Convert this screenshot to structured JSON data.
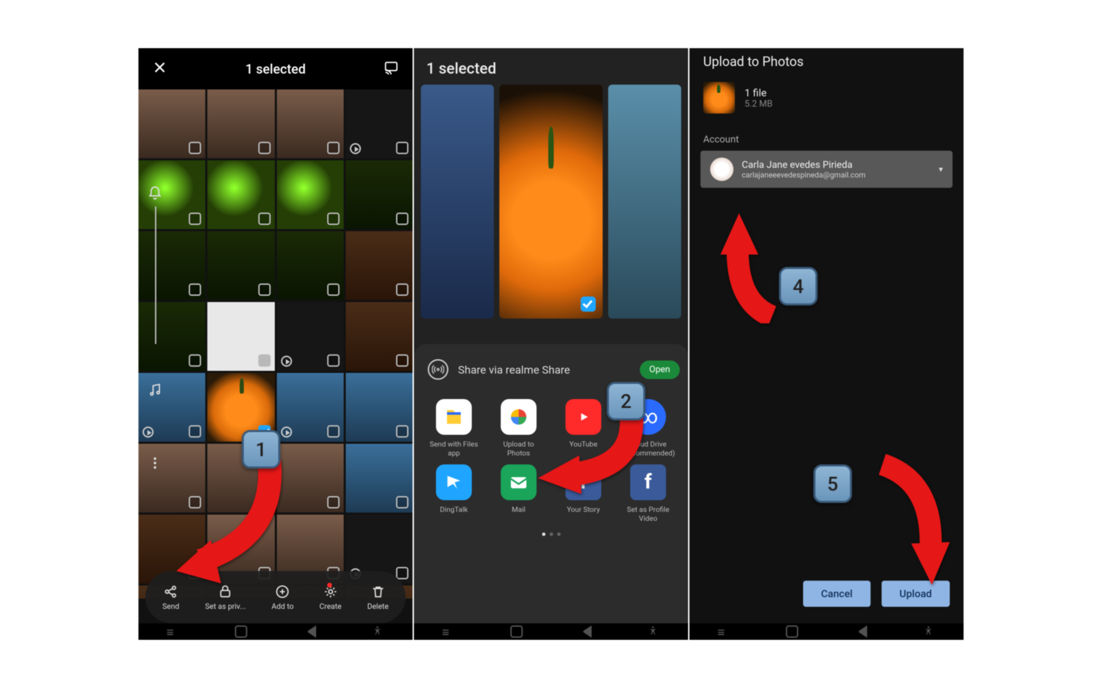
{
  "screen1": {
    "title": "1 selected",
    "actions": {
      "send": "Send",
      "private": "Set as priv...",
      "addto": "Add to",
      "create": "Create",
      "delete": "Delete"
    },
    "badge": "1"
  },
  "screen2": {
    "title": "1 selected",
    "realme": "Share via realme Share",
    "open": "Open",
    "apps": {
      "files": "Send with Files\napp",
      "photos": "Upload to\nPhotos",
      "youtube": "YouTube",
      "cloud": "Cloud Drive\n(Recommended)",
      "dingtalk": "DingTalk",
      "mail": "Mail",
      "story": "Your Story",
      "profile": "Set as Profile\nVideo"
    },
    "badge": "2"
  },
  "screen3": {
    "title": "Upload to Photos",
    "file_count": "1 file",
    "file_size": "5.2 MB",
    "account_label": "Account",
    "account_name": "Carla Jane evedes Pirieda",
    "account_email": "carlajaneeevedespineda@gmail.com",
    "cancel": "Cancel",
    "upload": "Upload",
    "badge4": "4",
    "badge5": "5"
  }
}
